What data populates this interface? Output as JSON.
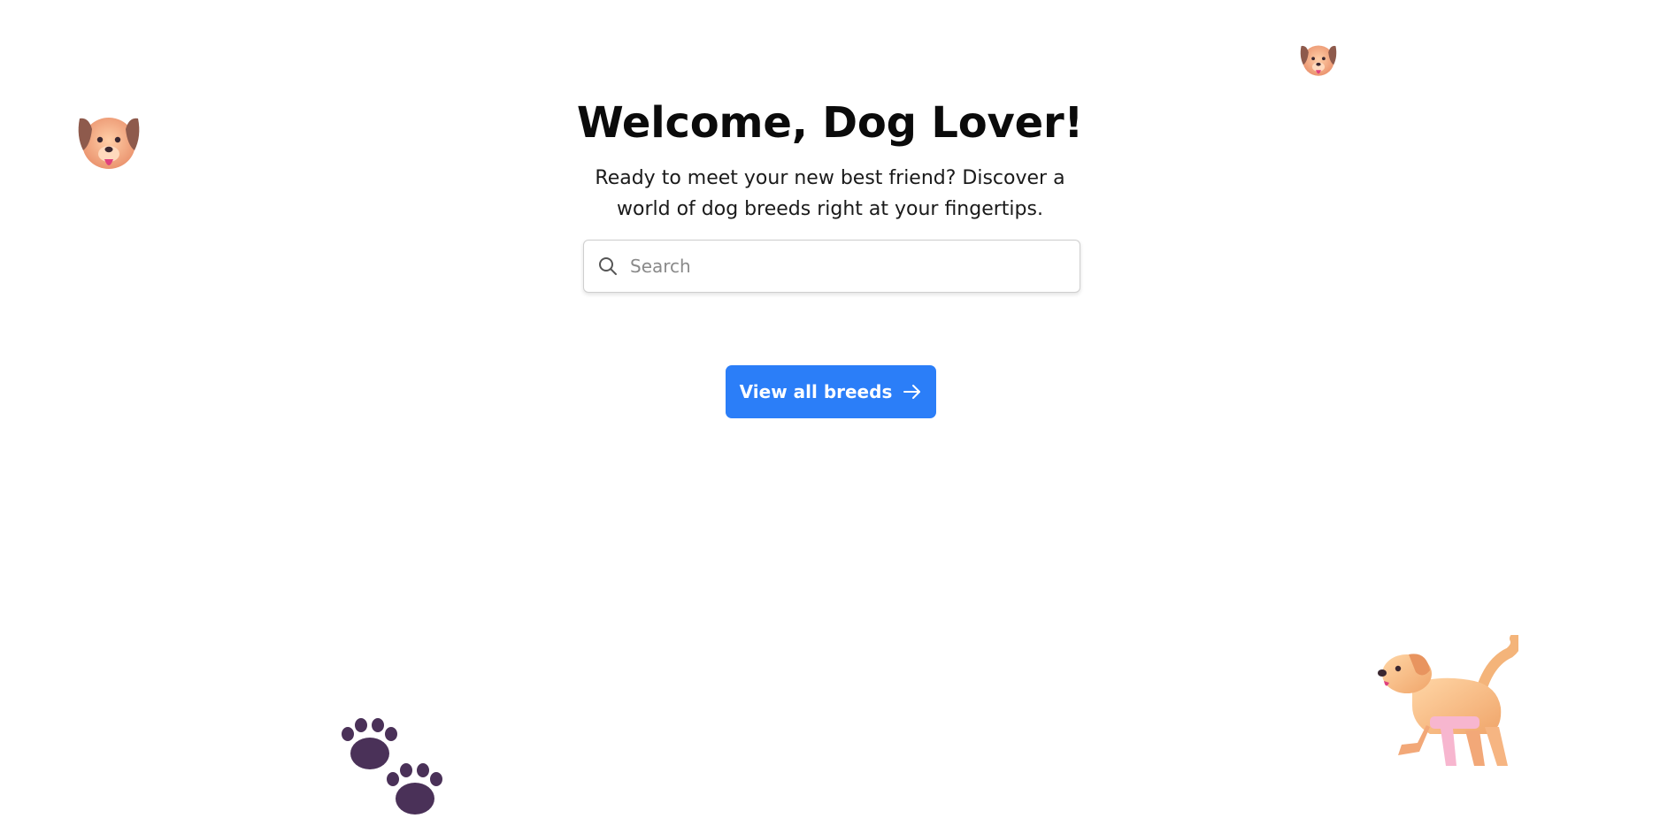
{
  "hero": {
    "title": "Welcome, Dog Lover!",
    "subtitle": "Ready to meet your new best friend? Discover a world of dog breeds right at your fingertips."
  },
  "search": {
    "placeholder": "Search",
    "value": "",
    "icon": "search-icon"
  },
  "cta": {
    "label": "View all breeds",
    "icon": "arrow-right-icon",
    "color": "#2b7ef8"
  },
  "decorations": [
    {
      "icon": "dog-face-icon"
    },
    {
      "icon": "dog-face-icon"
    },
    {
      "icon": "paw-prints-icon"
    },
    {
      "icon": "dog-icon"
    }
  ]
}
